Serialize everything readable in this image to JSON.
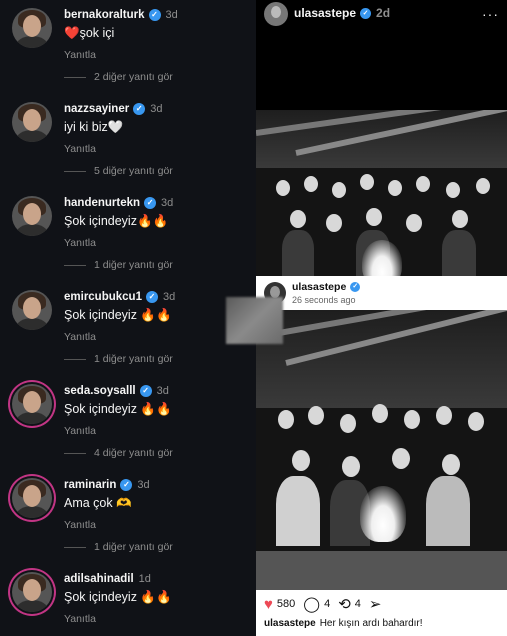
{
  "comments": [
    {
      "username": "bernakoralturk",
      "verified": true,
      "time": "3d",
      "text": "❤️şok içi",
      "reply": "Yanıtla",
      "more_replies": "2 diğer yanıtı gör",
      "ring": false
    },
    {
      "username": "nazzsayiner",
      "verified": true,
      "time": "3d",
      "text": "iyi ki biz🤍",
      "reply": "Yanıtla",
      "more_replies": "5 diğer yanıtı gör",
      "ring": false
    },
    {
      "username": "handenurtekn",
      "verified": true,
      "time": "3d",
      "text": "Şok içindeyiz🔥🔥",
      "reply": "Yanıtla",
      "more_replies": "1 diğer yanıtı gör",
      "ring": false
    },
    {
      "username": "emircubukcu1",
      "verified": true,
      "time": "3d",
      "text": "Şok içindeyiz 🔥🔥",
      "reply": "Yanıtla",
      "more_replies": "1 diğer yanıtı gör",
      "ring": false
    },
    {
      "username": "seda.soysalll",
      "verified": true,
      "time": "3d",
      "text": "Şok içindeyiz 🔥🔥",
      "reply": "Yanıtla",
      "more_replies": "4 diğer yanıtı gör",
      "ring": true
    },
    {
      "username": "raminarin",
      "verified": true,
      "time": "3d",
      "text": "Ama çok 🫶",
      "reply": "Yanıtla",
      "more_replies": "1 diğer yanıtı gör",
      "ring": true
    },
    {
      "username": "adilsahinadil",
      "verified": false,
      "time": "1d",
      "text": "Şok içindeyiz 🔥🔥",
      "reply": "Yanıtla",
      "more_replies": "",
      "ring": true
    }
  ],
  "post": {
    "username": "ulasastepe",
    "verified": true,
    "time": "2d",
    "more_icon": "···",
    "repost": {
      "username": "ulasastepe",
      "time": "26 seconds ago"
    },
    "likes": "580",
    "comments_count": "4",
    "reposts_count": "4",
    "caption_user": "ulasastepe",
    "caption_text": "Her kışın ardı bahardır!",
    "icons": {
      "like": "heart-icon",
      "comment": "comment-icon",
      "repost": "repost-icon",
      "share": "share-icon"
    }
  },
  "colors": {
    "verified": "#3897f0",
    "like": "#ed4956",
    "story_ring": "#c13584",
    "panel_bg": "#101217"
  }
}
